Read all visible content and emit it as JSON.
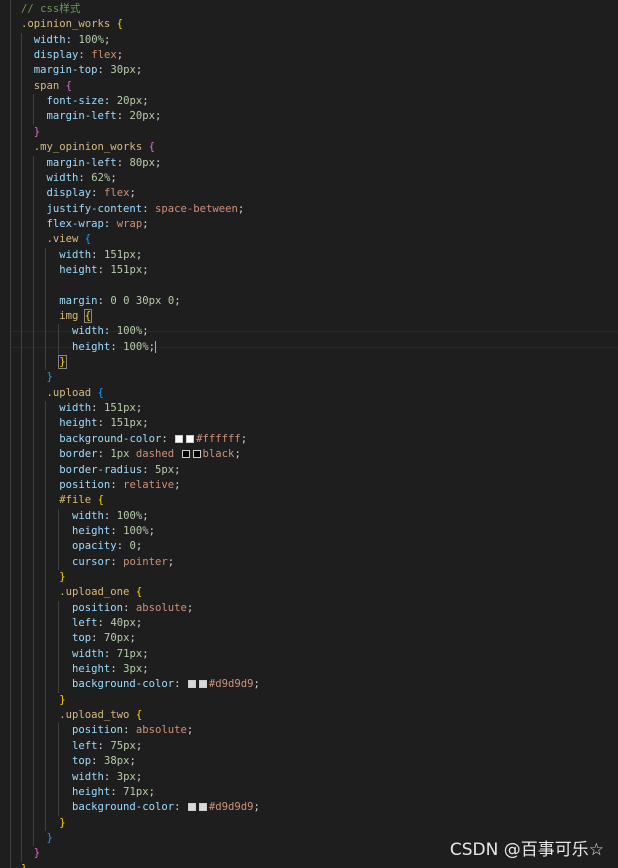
{
  "editor": {
    "comment_text": "// css样式",
    "watermark": "CSDN @百事可乐☆",
    "swatch_white": "#ffffff",
    "swatch_black": "#000000",
    "swatch_gray": "#d9d9d9"
  },
  "lines": [
    "// css样式",
    ".opinion_works {",
    "  width: 100%;",
    "  display: flex;",
    "  margin-top: 30px;",
    "  span {",
    "    font-size: 20px;",
    "    margin-left: 20px;",
    "  }",
    "  .my_opinion_works {",
    "    margin-left: 80px;",
    "    width: 62%;",
    "    display: flex;",
    "    justify-content: space-between;",
    "    flex-wrap: wrap;",
    "    .view {",
    "      width: 151px;",
    "      height: 151px;",
    "",
    "      margin: 0 0 30px 0;",
    "      img {",
    "        width: 100%;",
    "        height: 100%;",
    "      }",
    "    }",
    "    .upload {",
    "      width: 151px;",
    "      height: 151px;",
    "      background-color: #ffffff;",
    "      border: 1px dashed black;",
    "      border-radius: 5px;",
    "      position: relative;",
    "      #file {",
    "        width: 100%;",
    "        height: 100%;",
    "        opacity: 0;",
    "        cursor: pointer;",
    "      }",
    "      .upload_one {",
    "        position: absolute;",
    "        left: 40px;",
    "        top: 70px;",
    "        width: 71px;",
    "        height: 3px;",
    "        background-color: #d9d9d9;",
    "      }",
    "      .upload_two {",
    "        position: absolute;",
    "        left: 75px;",
    "        top: 38px;",
    "        width: 3px;",
    "        height: 71px;",
    "        background-color: #d9d9d9;",
    "      }",
    "    }",
    "  }",
    "}"
  ]
}
